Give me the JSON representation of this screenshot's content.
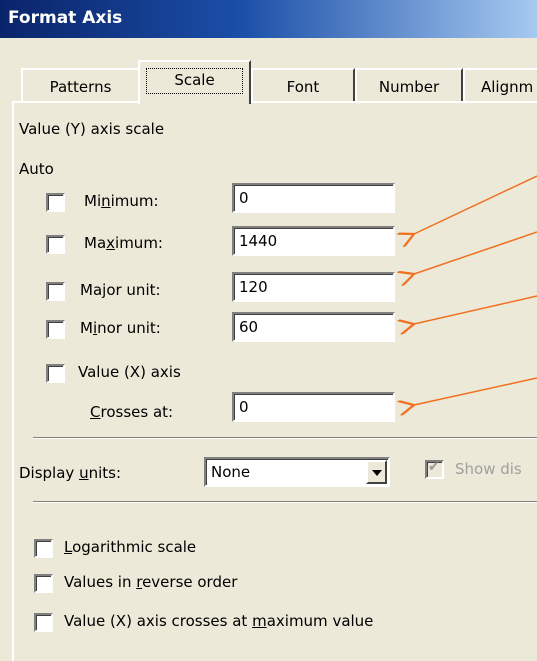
{
  "window": {
    "title": "Format Axis"
  },
  "tabs": [
    {
      "label": "Patterns",
      "active": false
    },
    {
      "label": "Scale",
      "active": true
    },
    {
      "label": "Font",
      "active": false
    },
    {
      "label": "Number",
      "active": false
    },
    {
      "label": "Alignm",
      "active": false
    }
  ],
  "scale": {
    "section_label": "Value (Y) axis scale",
    "auto_label": "Auto",
    "minimum": {
      "label": "Minimum:",
      "value": "0",
      "checked": false
    },
    "maximum": {
      "label": "Maximum:",
      "value": "1440",
      "checked": false
    },
    "major_unit": {
      "label": "Major unit:",
      "value": "120",
      "checked": false
    },
    "minor_unit": {
      "label": "Minor unit:",
      "value": "60",
      "checked": false
    },
    "crosses": {
      "label": "Value (X) axis",
      "sub_label": "Crosses at:",
      "value": "0",
      "checked": false
    }
  },
  "display_units": {
    "label": "Display units:",
    "selected": "None",
    "show_label": "Show dis",
    "show_checked": true
  },
  "options": [
    {
      "label": "Logarithmic scale",
      "checked": false
    },
    {
      "label": "Values in reverse order",
      "checked": false
    },
    {
      "label": "Value (X) axis crosses at maximum value",
      "checked": false
    }
  ],
  "annotation": {
    "arrow_color": "#f07020"
  },
  "colors": {
    "titlebar": "#0a246a",
    "dialog_bg": "#ece9d8"
  }
}
